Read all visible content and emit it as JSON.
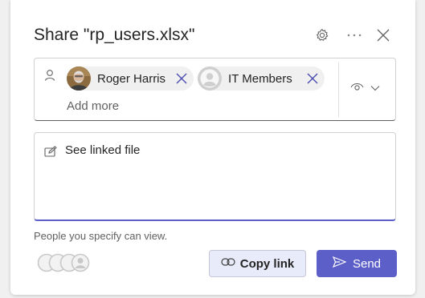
{
  "dialog": {
    "title": "Share \"rp_users.xlsx\"",
    "icons": {
      "settings": "gear-icon",
      "more": "more-options-icon",
      "close": "close-icon"
    }
  },
  "recipients": {
    "field_icon": "person-icon",
    "chips": [
      {
        "label": "Roger Harris",
        "avatar": "photo-avatar",
        "remove_icon": "close-icon"
      },
      {
        "label": "IT Members",
        "avatar": "group-placeholder-avatar",
        "remove_icon": "close-icon"
      }
    ],
    "placeholder": "Add more",
    "permission_icons": [
      "eye-icon",
      "chevron-down-icon"
    ]
  },
  "message": {
    "icon": "pencil-icon",
    "text": "See linked file"
  },
  "footer": {
    "note": "People you specify can view.",
    "copy_label": "Copy link",
    "copy_icon": "link-icon",
    "send_label": "Send",
    "send_icon": "send-icon"
  },
  "colors": {
    "accent": "#5b5fc7",
    "copy_bg": "#e8ebfa",
    "chip_bg": "#f0f0f0",
    "remove_x": "#4f52b2"
  }
}
